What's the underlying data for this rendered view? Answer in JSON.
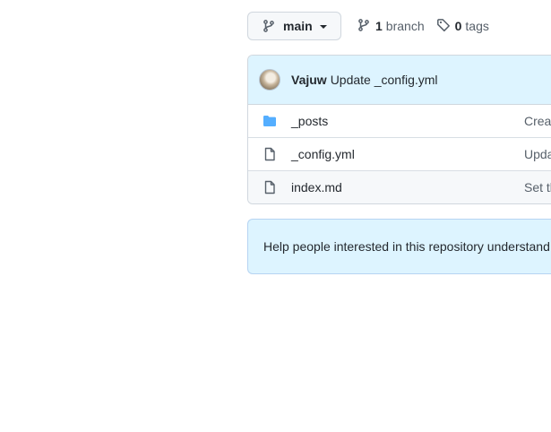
{
  "branch_selector": {
    "current_branch": "main"
  },
  "branches": {
    "count": "1",
    "label": "branch"
  },
  "tags": {
    "count": "0",
    "label": "tags"
  },
  "latest_commit": {
    "author": "Vajuw",
    "message": "Update _config.yml"
  },
  "files": [
    {
      "name": "_posts",
      "type": "folder",
      "commit_message": "Creat"
    },
    {
      "name": "_config.yml",
      "type": "file",
      "commit_message": "Upda"
    },
    {
      "name": "index.md",
      "type": "file",
      "commit_message": "Set th"
    }
  ],
  "readme_prompt": {
    "text": "Help people interested in this repository understand"
  },
  "colors": {
    "folder_icon": "#54aeff",
    "header_bg": "#ddf4ff",
    "border": "#d0d7de"
  }
}
